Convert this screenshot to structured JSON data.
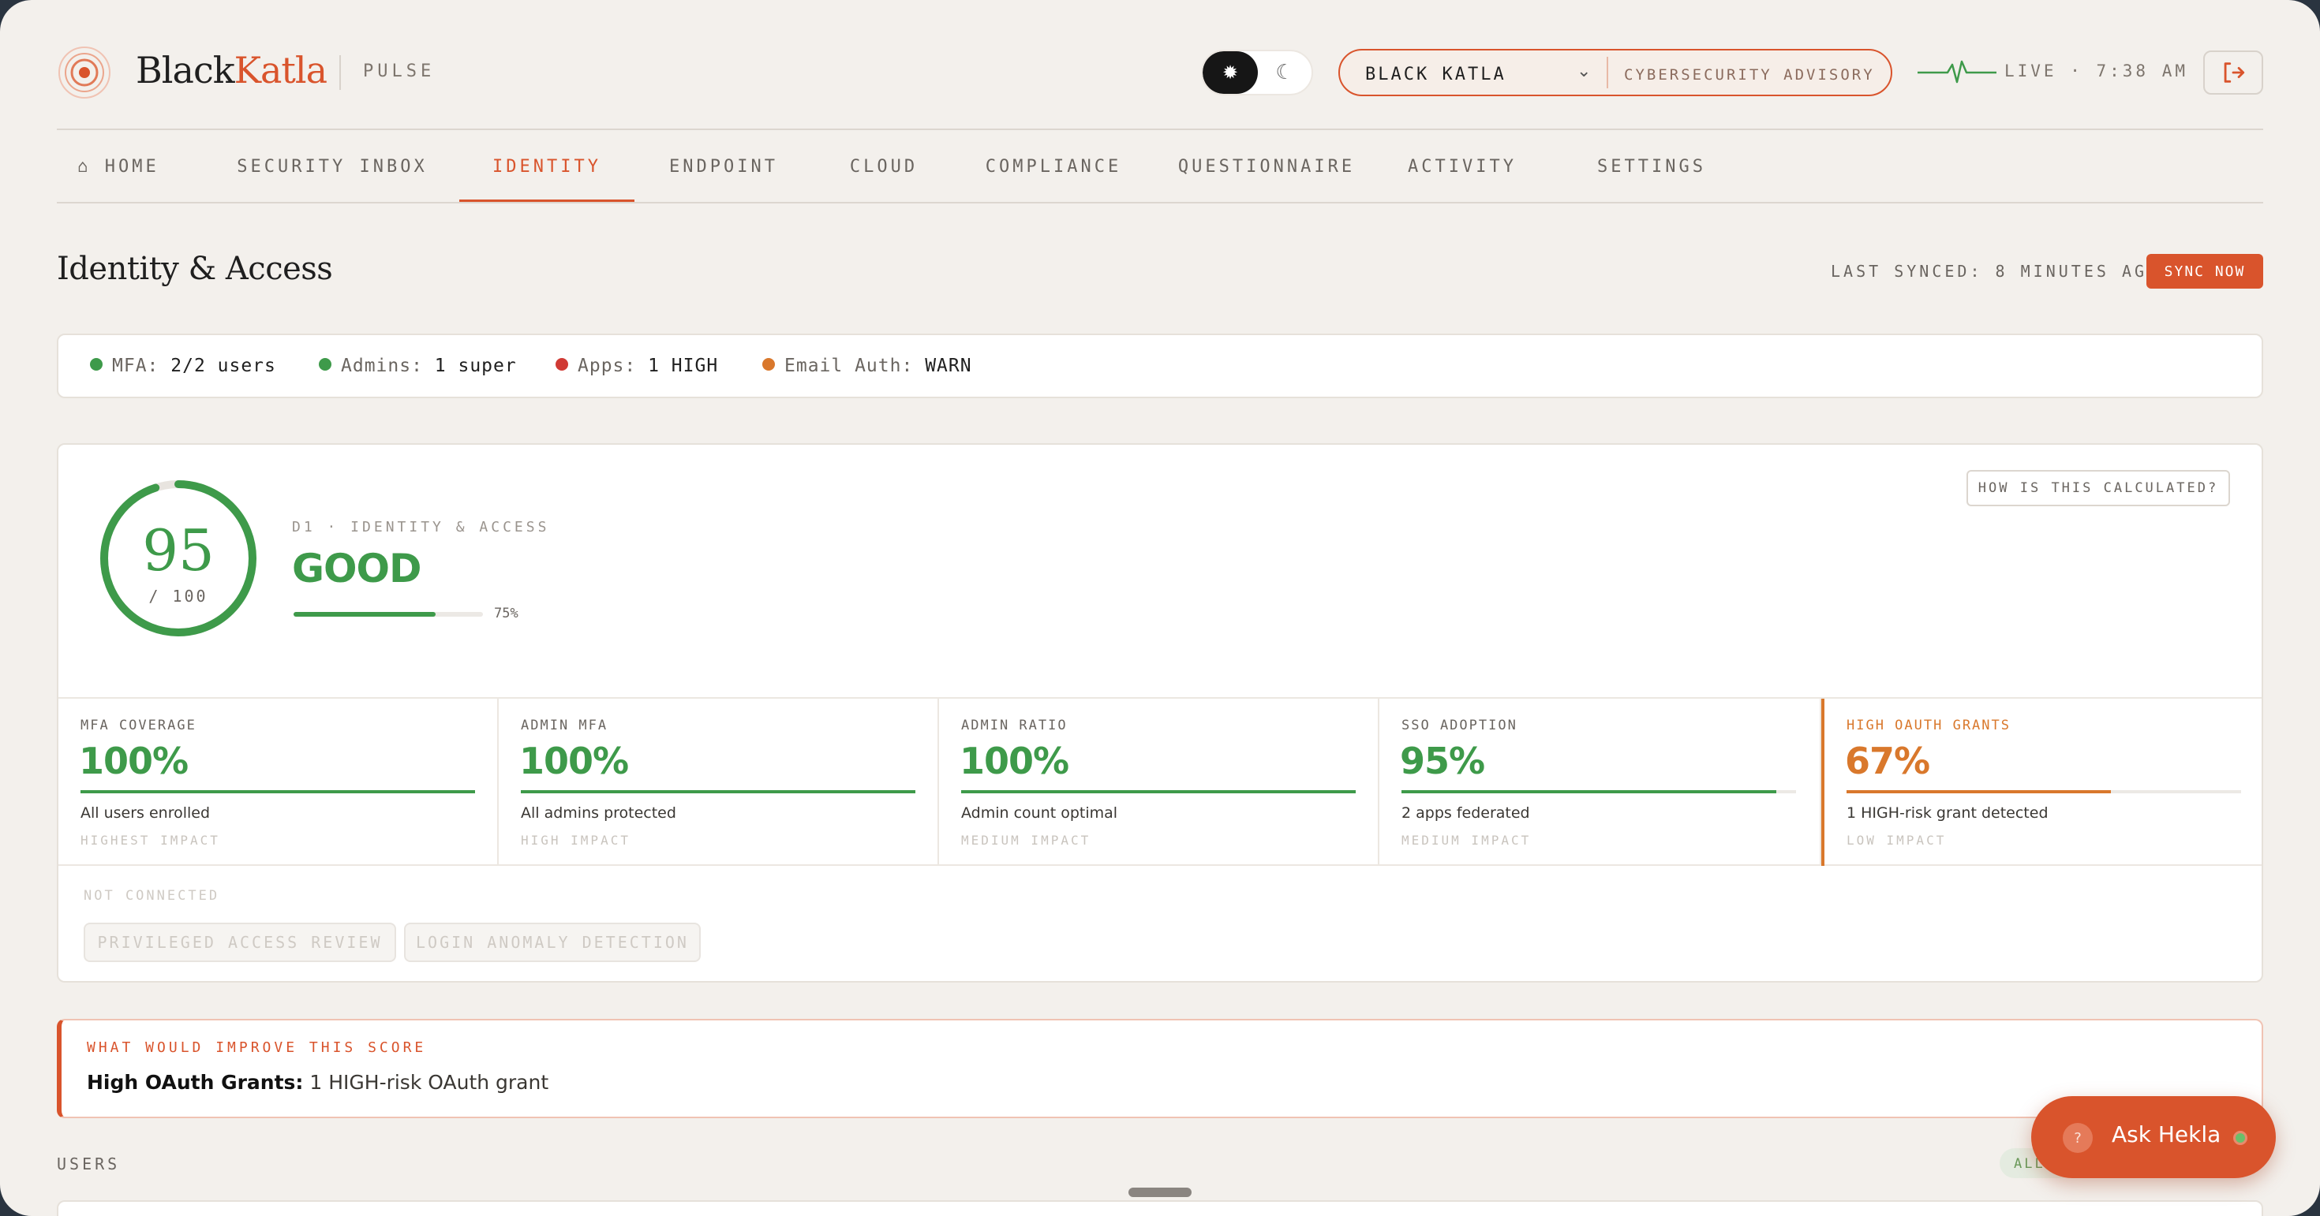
{
  "header": {
    "brand_primary": "Black",
    "brand_accent": "Katla",
    "product": "PULSE",
    "org_name": "BLACK KATLA",
    "org_tag": "CYBERSECURITY ADVISORY",
    "live_text": "LIVE · 7:38 AM",
    "icons": [
      "logo-icon",
      "sun-icon",
      "moon-icon",
      "chevron-down-icon",
      "pulse-icon",
      "logout-icon"
    ]
  },
  "nav": {
    "items": [
      {
        "label": "⌂ HOME"
      },
      {
        "label": "SECURITY INBOX"
      },
      {
        "label": "IDENTITY"
      },
      {
        "label": "ENDPOINT"
      },
      {
        "label": "CLOUD"
      },
      {
        "label": "COMPLIANCE"
      },
      {
        "label": "QUESTIONNAIRE"
      },
      {
        "label": "ACTIVITY"
      },
      {
        "label": "SETTINGS"
      }
    ],
    "active": "IDENTITY"
  },
  "page": {
    "title": "Identity & Access",
    "last_synced": "LAST SYNCED: 8 MINUTES AGO",
    "sync_button": "SYNC NOW"
  },
  "status_strip": [
    {
      "label": "MFA:",
      "value": "2/2 users",
      "color": "#3e9a4a"
    },
    {
      "label": "Admins:",
      "value": "1 super",
      "color": "#3e9a4a"
    },
    {
      "label": "Apps:",
      "value": "1 HIGH",
      "color": "#d03a34"
    },
    {
      "label": "Email Auth:",
      "value": "WARN",
      "color": "#d9782c"
    }
  ],
  "score": {
    "value": "95",
    "denominator": "/ 100",
    "domain_label": "D1 · IDENTITY & ACCESS",
    "grade": "GOOD",
    "progress_fraction": 0.75,
    "progress_label": "75%",
    "how_button": "HOW IS THIS CALCULATED?"
  },
  "metrics": [
    {
      "label": "MFA COVERAGE",
      "value": "100%",
      "fraction": 1.0,
      "desc": "All users enrolled",
      "impact": "HIGHEST IMPACT"
    },
    {
      "label": "ADMIN MFA",
      "value": "100%",
      "fraction": 1.0,
      "desc": "All admins protected",
      "impact": "HIGH IMPACT"
    },
    {
      "label": "ADMIN RATIO",
      "value": "100%",
      "fraction": 1.0,
      "desc": "Admin count optimal",
      "impact": "MEDIUM IMPACT"
    },
    {
      "label": "SSO ADOPTION",
      "value": "95%",
      "fraction": 0.95,
      "desc": "2 apps federated",
      "impact": "MEDIUM IMPACT"
    },
    {
      "label": "HIGH OAUTH GRANTS",
      "value": "67%",
      "fraction": 0.67,
      "desc": "1 HIGH-risk grant detected",
      "impact": "LOW IMPACT"
    }
  ],
  "not_connected": {
    "label": "NOT CONNECTED",
    "items": [
      "PRIVILEGED ACCESS REVIEW",
      "LOGIN ANOMALY DETECTION"
    ]
  },
  "improve": {
    "label": "WHAT WOULD IMPROVE THIS SCORE",
    "bold": "High OAuth Grants:",
    "text": " 1 HIGH-risk OAuth grant"
  },
  "users": {
    "label": "USERS",
    "pill": "ALL"
  },
  "assistant": {
    "label": "Ask Hekla",
    "icon": "?"
  },
  "colors": {
    "accent": "#d9542c",
    "good": "#3e9a4a",
    "warn": "#d9782c",
    "bad": "#d03a34",
    "background": "#f3f0ec"
  }
}
